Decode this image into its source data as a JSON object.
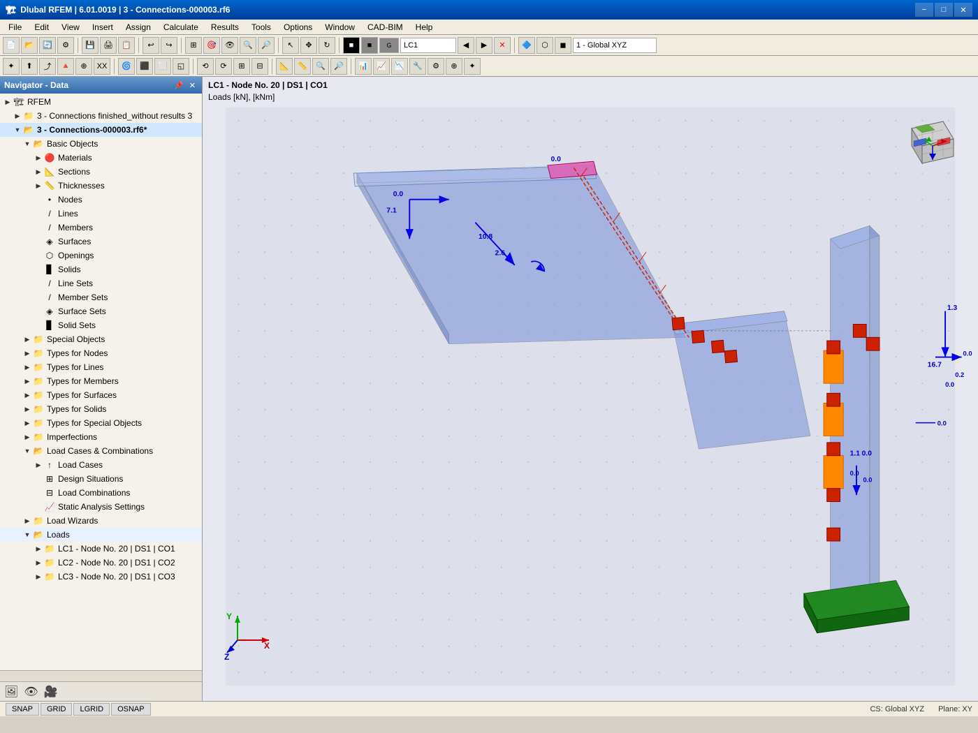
{
  "titlebar": {
    "title": "Dlubal RFEM | 6.01.0019 | 3 - Connections-000003.rf6",
    "app_icon": "🏗",
    "min_label": "−",
    "max_label": "□",
    "close_label": "✕"
  },
  "menubar": {
    "items": [
      "File",
      "Edit",
      "View",
      "Insert",
      "Assign",
      "Calculate",
      "Results",
      "Tools",
      "Options",
      "Window",
      "CAD-BIM",
      "Help"
    ]
  },
  "navigator": {
    "title": "Navigator - Data",
    "pin_icon": "📌",
    "close_icon": "✕",
    "tree": [
      {
        "id": "rfem",
        "level": 0,
        "arrow": "▶",
        "icon": "🏗",
        "label": "RFEM",
        "folder": false
      },
      {
        "id": "conn-finished",
        "level": 1,
        "arrow": "▶",
        "icon": "📁",
        "label": "3 - Connections finished_without results 3",
        "folder": true
      },
      {
        "id": "conn-000003",
        "level": 1,
        "arrow": "▼",
        "icon": "📁",
        "label": "3 - Connections-000003.rf6*",
        "folder": true,
        "bold": true
      },
      {
        "id": "basic-objects",
        "level": 2,
        "arrow": "▼",
        "icon": "📁",
        "label": "Basic Objects",
        "folder": true
      },
      {
        "id": "materials",
        "level": 3,
        "arrow": "▶",
        "icon": "🔴",
        "label": "Materials",
        "folder": false
      },
      {
        "id": "sections",
        "level": 3,
        "arrow": "▶",
        "icon": "📐",
        "label": "Sections",
        "folder": false
      },
      {
        "id": "thicknesses",
        "level": 3,
        "arrow": "▶",
        "icon": "📏",
        "label": "Thicknesses",
        "folder": false
      },
      {
        "id": "nodes",
        "level": 3,
        "arrow": "",
        "icon": "•",
        "label": "Nodes",
        "folder": false
      },
      {
        "id": "lines",
        "level": 3,
        "arrow": "",
        "icon": "╱",
        "label": "Lines",
        "folder": false
      },
      {
        "id": "members",
        "level": 3,
        "arrow": "",
        "icon": "╱",
        "label": "Members",
        "folder": false
      },
      {
        "id": "surfaces",
        "level": 3,
        "arrow": "",
        "icon": "🔷",
        "label": "Surfaces",
        "folder": false
      },
      {
        "id": "openings",
        "level": 3,
        "arrow": "",
        "icon": "📂",
        "label": "Openings",
        "folder": false
      },
      {
        "id": "solids",
        "level": 3,
        "arrow": "",
        "icon": "📦",
        "label": "Solids",
        "folder": false
      },
      {
        "id": "line-sets",
        "level": 3,
        "arrow": "",
        "icon": "╱",
        "label": "Line Sets",
        "folder": false
      },
      {
        "id": "member-sets",
        "level": 3,
        "arrow": "",
        "icon": "╱",
        "label": "Member Sets",
        "folder": false
      },
      {
        "id": "surface-sets",
        "level": 3,
        "arrow": "",
        "icon": "🔷",
        "label": "Surface Sets",
        "folder": false
      },
      {
        "id": "solid-sets",
        "level": 3,
        "arrow": "",
        "icon": "📦",
        "label": "Solid Sets",
        "folder": false
      },
      {
        "id": "special-objects",
        "level": 2,
        "arrow": "▶",
        "icon": "📁",
        "label": "Special Objects",
        "folder": true
      },
      {
        "id": "types-nodes",
        "level": 2,
        "arrow": "▶",
        "icon": "📁",
        "label": "Types for Nodes",
        "folder": true
      },
      {
        "id": "types-lines",
        "level": 2,
        "arrow": "▶",
        "icon": "📁",
        "label": "Types for Lines",
        "folder": true
      },
      {
        "id": "types-members",
        "level": 2,
        "arrow": "▶",
        "icon": "📁",
        "label": "Types for Members",
        "folder": true
      },
      {
        "id": "types-surfaces",
        "level": 2,
        "arrow": "▶",
        "icon": "📁",
        "label": "Types for Surfaces",
        "folder": true
      },
      {
        "id": "types-solids",
        "level": 2,
        "arrow": "▶",
        "icon": "📁",
        "label": "Types for Solids",
        "folder": true
      },
      {
        "id": "types-special",
        "level": 2,
        "arrow": "▶",
        "icon": "📁",
        "label": "Types for Special Objects",
        "folder": true
      },
      {
        "id": "imperfections",
        "level": 2,
        "arrow": "▶",
        "icon": "📁",
        "label": "Imperfections",
        "folder": true
      },
      {
        "id": "load-cases-comb",
        "level": 2,
        "arrow": "▼",
        "icon": "📁",
        "label": "Load Cases & Combinations",
        "folder": true
      },
      {
        "id": "load-cases",
        "level": 3,
        "arrow": "▶",
        "icon": "⬆",
        "label": "Load Cases",
        "folder": false
      },
      {
        "id": "design-situations",
        "level": 3,
        "arrow": "",
        "icon": "📊",
        "label": "Design Situations",
        "folder": false
      },
      {
        "id": "load-combinations",
        "level": 3,
        "arrow": "",
        "icon": "📊",
        "label": "Load Combinations",
        "folder": false
      },
      {
        "id": "static-analysis",
        "level": 3,
        "arrow": "",
        "icon": "📈",
        "label": "Static Analysis Settings",
        "folder": false
      },
      {
        "id": "load-wizards",
        "level": 2,
        "arrow": "▶",
        "icon": "📁",
        "label": "Load Wizards",
        "folder": true
      },
      {
        "id": "loads",
        "level": 2,
        "arrow": "▼",
        "icon": "📁",
        "label": "Loads",
        "folder": true
      },
      {
        "id": "lc1",
        "level": 3,
        "arrow": "▶",
        "icon": "📁",
        "label": "LC1 - Node No. 20 | DS1 | CO1",
        "folder": true
      },
      {
        "id": "lc2",
        "level": 3,
        "arrow": "▶",
        "icon": "📁",
        "label": "LC2 - Node No. 20 | DS1 | CO2",
        "folder": true
      },
      {
        "id": "lc3",
        "level": 3,
        "arrow": "▶",
        "icon": "📁",
        "label": "LC3 - Node No. 20 | DS1 | CO3",
        "folder": true
      }
    ],
    "bottom_icons": [
      "🖼",
      "👁",
      "🎥"
    ]
  },
  "viewport": {
    "header_line1": "LC1 - Node No. 20 | DS1 | CO1",
    "header_line2": "Loads [kN], [kNm]"
  },
  "toolbar_right": {
    "coordinate_system": "1 - Global XYZ",
    "lc_label": "LC1"
  },
  "statusbar": {
    "snap_label": "SNAP",
    "grid_label": "GRID",
    "lgrid_label": "LGRID",
    "osnap_label": "OSNAP",
    "cs_text": "CS: Global XYZ",
    "plane_text": "Plane: XY"
  }
}
